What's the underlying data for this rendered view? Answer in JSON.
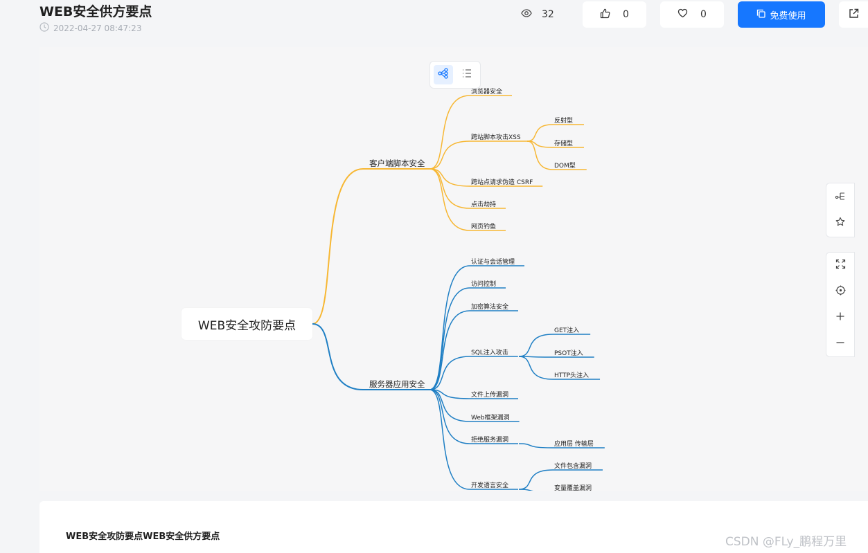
{
  "page": {
    "title": "WEB安全供方要点",
    "datetime": "2022-04-27 08:47:23"
  },
  "stats": {
    "views": "32",
    "likes": "0",
    "favorites": "0"
  },
  "actions": {
    "use_label": "免费使用"
  },
  "icons": {
    "clock": "clock-icon",
    "views": "eye-icon",
    "like": "thumbs-up-icon",
    "favorite": "heart-icon",
    "use": "copy-icon",
    "share": "external-link-icon",
    "view_mindmap": "mindmap-view-icon",
    "view_outline": "outline-view-icon",
    "tool_layout": "layout-icon",
    "tool_style": "style-icon",
    "tool_fit": "fit-screen-icon",
    "tool_center": "locate-icon",
    "tool_zoom_in": "zoom-in-icon",
    "tool_zoom_out": "zoom-out-icon"
  },
  "colors": {
    "accent": "#1677ff",
    "branch_client": "#f7b733",
    "branch_server": "#1f7fc4"
  },
  "mindmap": {
    "root": "WEB安全攻防要点",
    "branches": [
      {
        "label": "客户端脚本安全",
        "children": [
          {
            "label": "浏览器安全",
            "children": []
          },
          {
            "label": "跨站脚本攻击XSS",
            "children": [
              "反射型",
              "存储型",
              "DOM型"
            ]
          },
          {
            "label": "跨站点请求伪造 CSRF",
            "children": []
          },
          {
            "label": "点击劫持",
            "children": []
          },
          {
            "label": "网页钓鱼",
            "children": []
          }
        ]
      },
      {
        "label": "服务器应用安全",
        "children": [
          {
            "label": "认证与会话管理",
            "children": []
          },
          {
            "label": "访问控制",
            "children": []
          },
          {
            "label": "加密算法安全",
            "children": []
          },
          {
            "label": "SQL注入攻击",
            "children": [
              "GET注入",
              "PSOT注入",
              "HTTP头注入"
            ]
          },
          {
            "label": "文件上传漏洞",
            "children": []
          },
          {
            "label": "Web框架漏洞",
            "children": []
          },
          {
            "label": "拒绝服务漏洞",
            "children": [
              "应用层 传输层"
            ]
          },
          {
            "label": "开发语言安全",
            "children": [
              "文件包含漏洞",
              "变量覆盖漏洞"
            ]
          }
        ]
      }
    ]
  },
  "bottom": {
    "title": "WEB安全攻防要点WEB安全供方要点"
  },
  "watermark": "CSDN @FLy_鹏程万里"
}
